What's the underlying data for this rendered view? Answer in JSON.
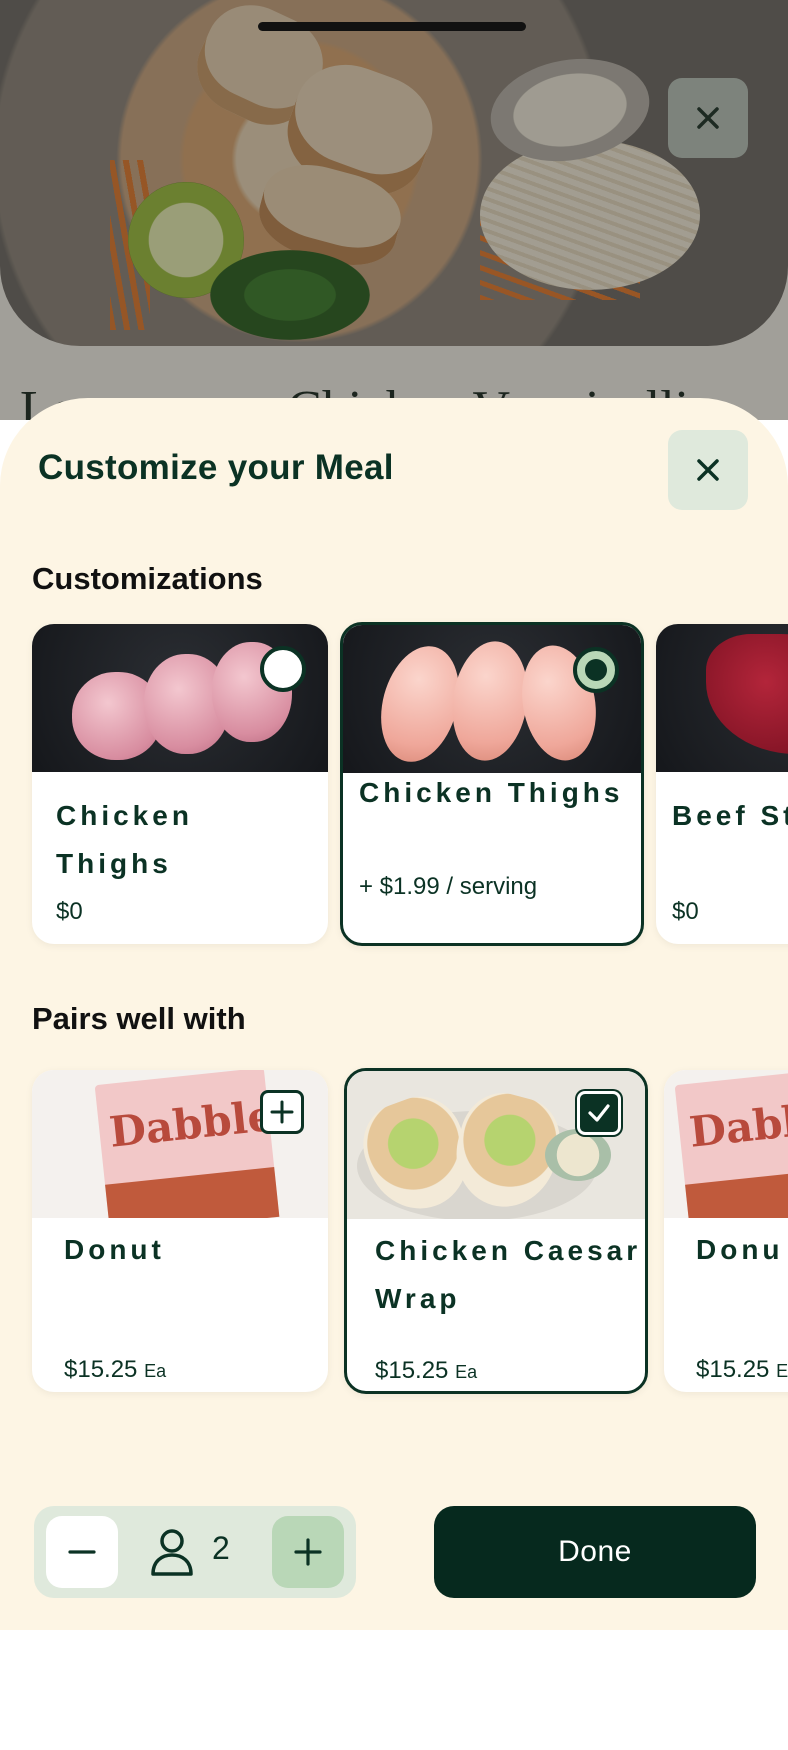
{
  "background": {
    "recipe_title_partial": "Lemongrass Chicken Vermicelli"
  },
  "sheet": {
    "title": "Customize your Meal",
    "close_icon": "close-icon"
  },
  "customizations": {
    "heading": "Customizations",
    "items": [
      {
        "name": "Chicken Thighs",
        "price": "$0",
        "selected": false,
        "image": "chicken-thighs-photo"
      },
      {
        "name": "Chicken Thighs",
        "price": "+ $1.99 / serving",
        "selected": true,
        "image": "chicken-breasts-photo"
      },
      {
        "name": "Beef St",
        "price": "$0",
        "selected": false,
        "image": "beef-steak-photo"
      }
    ]
  },
  "pairs": {
    "heading": "Pairs well with",
    "items": [
      {
        "name": "Donut",
        "price": "$15.25",
        "unit": "Ea",
        "added": false,
        "image": "dabble-donuts-photo"
      },
      {
        "name": "Chicken Caesar Wrap",
        "price": "$15.25",
        "unit": "Ea",
        "added": true,
        "image": "caesar-wrap-photo"
      },
      {
        "name": "Donu",
        "price": "$15.25",
        "unit": "E",
        "added": false,
        "image": "dabble-donuts-photo"
      }
    ]
  },
  "footer": {
    "servings": "2",
    "done_label": "Done"
  },
  "colors": {
    "brand_dark": "#0b3224",
    "sheet_bg": "#fdf5e4",
    "accent_light": "#dfe9dc",
    "accent_mid": "#b9d7b7"
  }
}
